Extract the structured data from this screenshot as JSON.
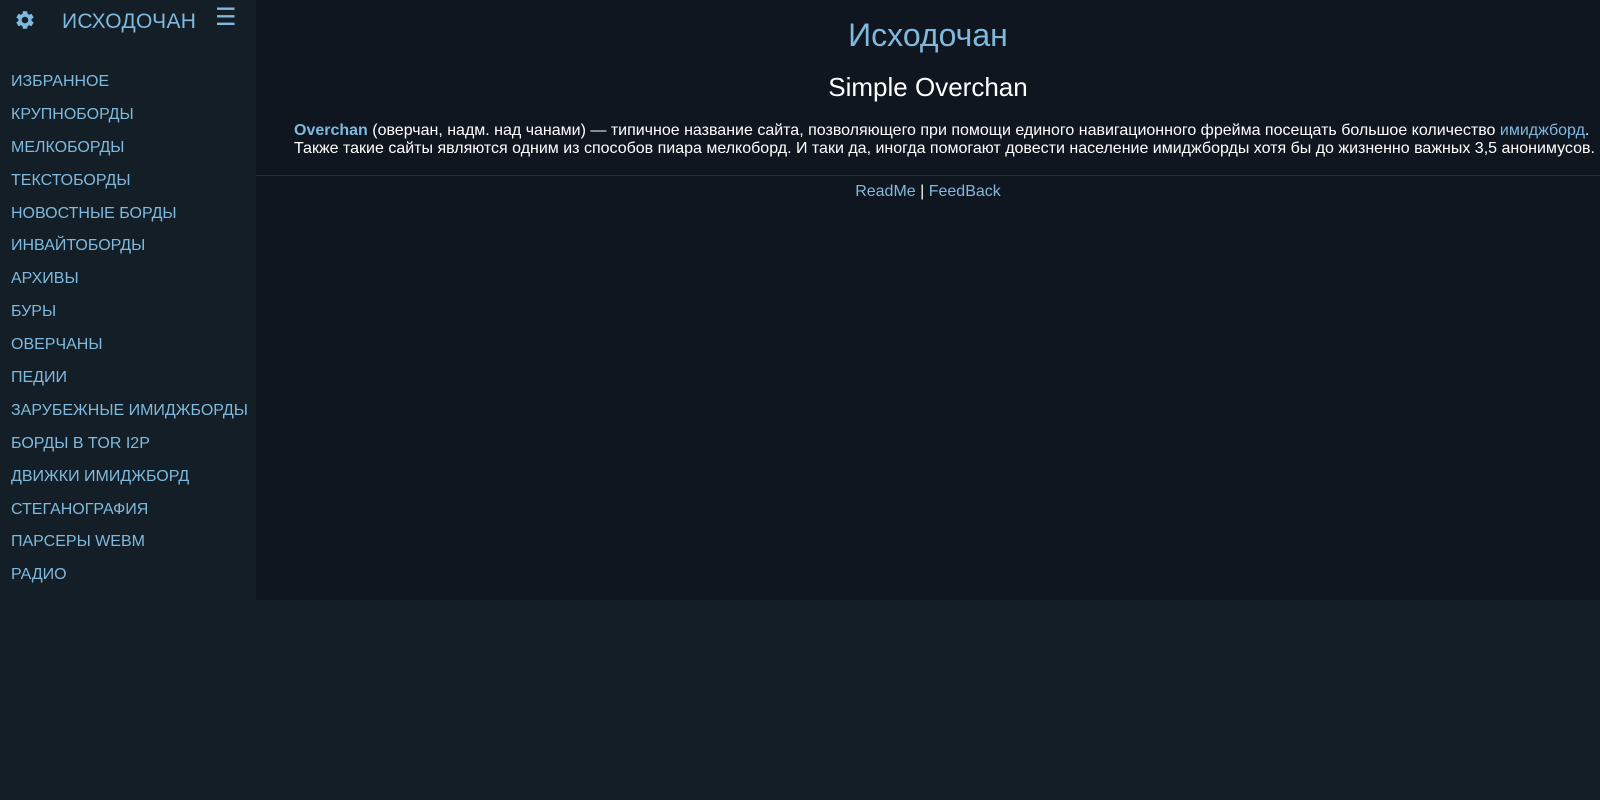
{
  "header": {
    "site_name": "ИСХОДОЧАН",
    "settings_icon": "gear-icon",
    "menu_icon": "hamburger-icon",
    "menu_glyph": "☰"
  },
  "sidebar": {
    "items": [
      {
        "label": "ИЗБРАННОЕ"
      },
      {
        "label": "КРУПНОБОРДЫ"
      },
      {
        "label": "МЕЛКОБОРДЫ"
      },
      {
        "label": "ТЕКСТОБОРДЫ"
      },
      {
        "label": "НОВОСТНЫЕ БОРДЫ"
      },
      {
        "label": "ИНВАЙТОБОРДЫ"
      },
      {
        "label": "АРХИВЫ"
      },
      {
        "label": "БУРЫ"
      },
      {
        "label": "ОВЕРЧАНЫ"
      },
      {
        "label": "ПЕДИИ"
      },
      {
        "label": "ЗАРУБЕЖНЫЕ ИМИДЖБОРДЫ"
      },
      {
        "label": "БОРДЫ В TOR I2P"
      },
      {
        "label": "ДВИЖКИ ИМИДЖБОРД"
      },
      {
        "label": "СТЕГАНОГРАФИЯ"
      },
      {
        "label": "ПАРСЕРЫ WEBM"
      },
      {
        "label": "РАДИО"
      }
    ]
  },
  "main": {
    "title": "Исходочан",
    "subtitle": "Simple Overchan",
    "description": {
      "brand": "Overchan",
      "text1": " (оверчан, надм. над чанами) — типичное название сайта, позволяющего при помощи единого навигационного фрейма посещать большое количество ",
      "link": "имиджборд",
      "text2": ".",
      "line2": "Также такие сайты являются одним из способов пиара мелкоборд. И таки да, иногда помогают довести население имиджборды хотя бы до жизненно важных 3,5 анонимусов."
    },
    "footer": {
      "readme": "ReadMe",
      "separator": " | ",
      "feedback": "FeedBack"
    }
  },
  "colors": {
    "accent": "#7fb9de",
    "sidebar_bg": "#141e26",
    "main_bg": "#0f161f",
    "text": "#ffffff"
  }
}
